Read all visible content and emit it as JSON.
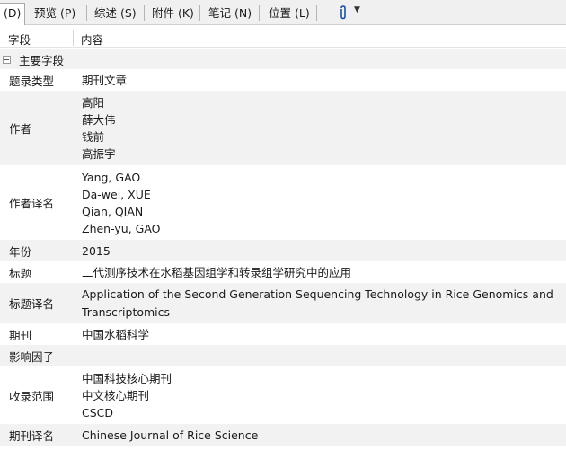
{
  "tabs": [
    {
      "label": "(D)"
    },
    {
      "label": "预览 (P)"
    },
    {
      "label": "综述 (S)"
    },
    {
      "label": "附件 (K)"
    },
    {
      "label": "笔记 (N)"
    },
    {
      "label": "位置 (L)"
    }
  ],
  "header": {
    "field": "字段",
    "content": "内容"
  },
  "section": {
    "label": "主要字段"
  },
  "rows": [
    {
      "key": "题录类型",
      "values": [
        "期刊文章"
      ]
    },
    {
      "key": "作者",
      "values": [
        "高阳",
        "薛大伟",
        "钱前",
        "高振宇"
      ]
    },
    {
      "key": "作者译名",
      "values": [
        "Yang, GAO",
        "Da-wei, XUE",
        "Qian, QIAN",
        "Zhen-yu, GAO"
      ]
    },
    {
      "key": "年份",
      "values": [
        "2015"
      ]
    },
    {
      "key": "标题",
      "values": [
        "二代测序技术在水稻基因组学和转录组学研究中的应用"
      ]
    },
    {
      "key": "标题译名",
      "values": [
        "Application of the Second Generation Sequencing Technology in Rice Genomics and",
        "Transcriptomics"
      ]
    },
    {
      "key": "期刊",
      "values": [
        "中国水稻科学"
      ]
    },
    {
      "key": "影响因子",
      "values": []
    },
    {
      "key": "收录范围",
      "values": [
        "中国科技核心期刊",
        "中文核心期刊",
        "CSCD"
      ]
    },
    {
      "key": "期刊译名",
      "values": [
        "Chinese Journal of Rice Science"
      ]
    }
  ],
  "icons": {
    "attachment": "paperclip-icon",
    "dropdown": "dropdown-arrow-icon",
    "collapse": "collapse-icon"
  }
}
